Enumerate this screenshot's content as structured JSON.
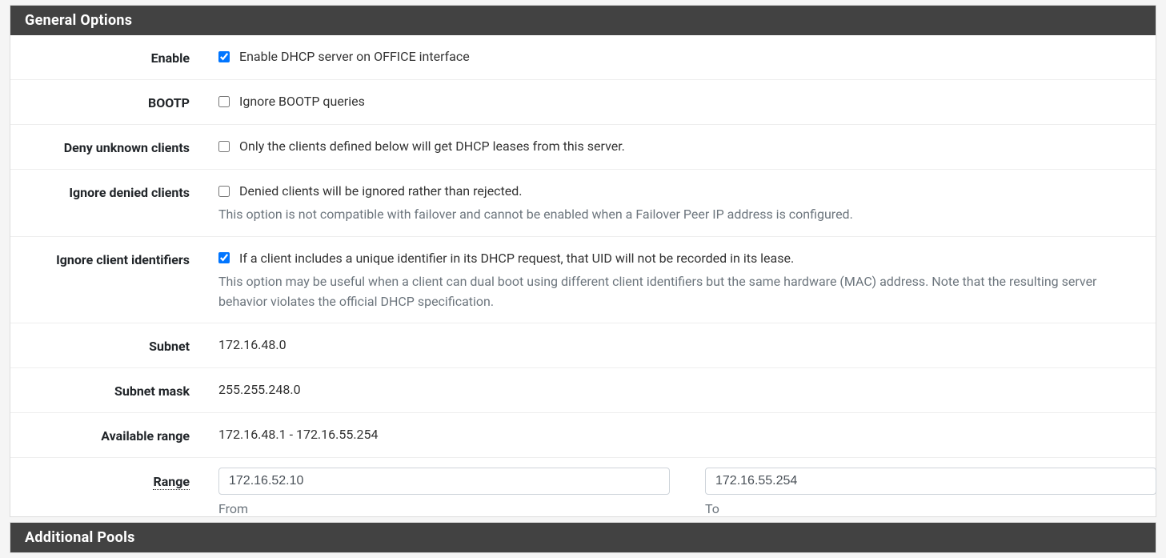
{
  "panels": {
    "general": {
      "title": "General Options"
    },
    "pools": {
      "title": "Additional Pools"
    }
  },
  "rows": {
    "enable": {
      "label": "Enable",
      "checked": true,
      "text": "Enable DHCP server on OFFICE interface"
    },
    "bootp": {
      "label": "BOOTP",
      "checked": false,
      "text": "Ignore BOOTP queries"
    },
    "deny_unknown": {
      "label": "Deny unknown clients",
      "checked": false,
      "text": "Only the clients defined below will get DHCP leases from this server."
    },
    "ignore_denied": {
      "label": "Ignore denied clients",
      "checked": false,
      "text": "Denied clients will be ignored rather than rejected.",
      "help": "This option is not compatible with failover and cannot be enabled when a Failover Peer IP address is configured."
    },
    "ignore_client_ids": {
      "label": "Ignore client identifiers",
      "checked": true,
      "text": "If a client includes a unique identifier in its DHCP request, that UID will not be recorded in its lease.",
      "help": "This option may be useful when a client can dual boot using different client identifiers but the same hardware (MAC) address. Note that the resulting server behavior violates the official DHCP specification."
    },
    "subnet": {
      "label": "Subnet",
      "value": "172.16.48.0"
    },
    "subnet_mask": {
      "label": "Subnet mask",
      "value": "255.255.248.0"
    },
    "available_range": {
      "label": "Available range",
      "value": "172.16.48.1 - 172.16.55.254"
    },
    "range": {
      "label": "Range",
      "from_value": "172.16.52.10",
      "from_label": "From",
      "to_value": "172.16.55.254",
      "to_label": "To"
    }
  }
}
